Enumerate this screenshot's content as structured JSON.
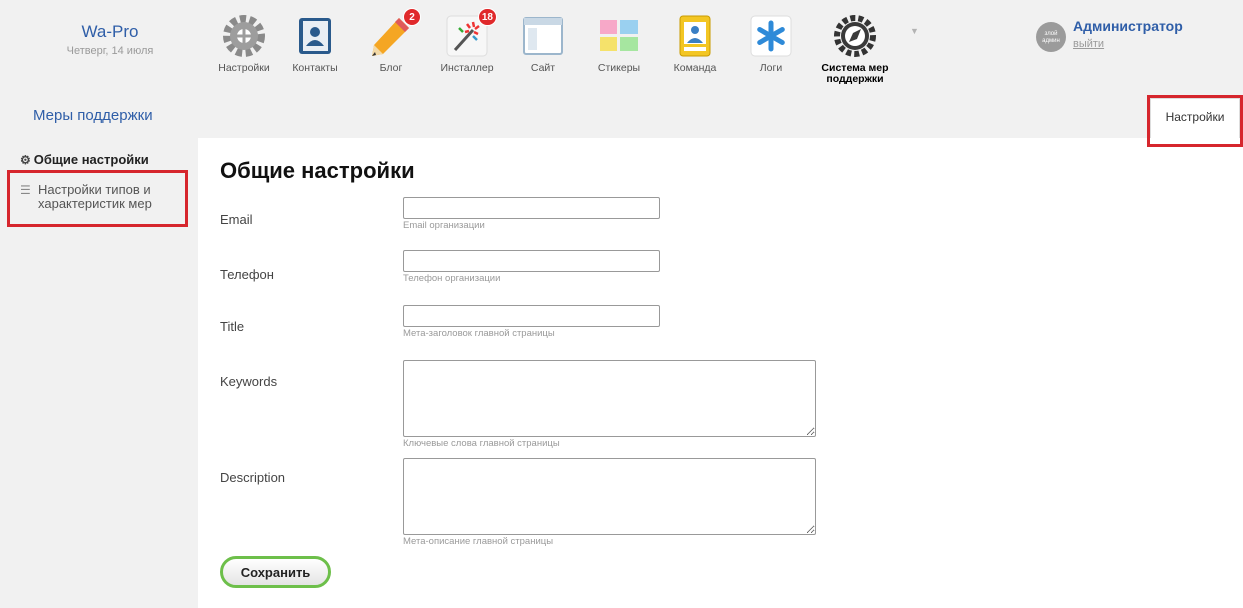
{
  "brand": {
    "name": "Wa-Pro",
    "date": "Четверг, 14 июля"
  },
  "apps": [
    {
      "label": "Настройки",
      "icon": "settings-gear-icon"
    },
    {
      "label": "Контакты",
      "icon": "contacts-book-icon"
    },
    {
      "label": "Блог",
      "icon": "pencil-icon",
      "badge": "2"
    },
    {
      "label": "Инсталлер",
      "icon": "installer-sparkle-icon",
      "badge": "18"
    },
    {
      "label": "Сайт",
      "icon": "site-window-icon"
    },
    {
      "label": "Стикеры",
      "icon": "stickers-icon"
    },
    {
      "label": "Команда",
      "icon": "team-badge-icon"
    },
    {
      "label": "Логи",
      "icon": "logs-asterisk-icon"
    },
    {
      "label": "Система мер поддержки",
      "icon": "support-system-compass-icon"
    }
  ],
  "user": {
    "avatar_text": "злой админ",
    "name": "Администратор",
    "logout": "выйти"
  },
  "app_header": {
    "title": "Меры поддержки",
    "tab_settings": "Настройки"
  },
  "sidebar": [
    {
      "label": "Общие настройки",
      "icon": "gears-icon",
      "active": true
    },
    {
      "label": "Настройки типов и характеристик мер",
      "icon": "list-icon",
      "active": false
    }
  ],
  "form": {
    "title": "Общие настройки",
    "fields": [
      {
        "label": "Email",
        "value": "",
        "hint": "Email организации"
      },
      {
        "label": "Телефон",
        "value": "",
        "hint": "Телефон организации"
      },
      {
        "label": "Title",
        "value": "",
        "hint": "Мета-заголовок главной страницы"
      },
      {
        "label": "Keywords",
        "value": "",
        "hint": "Ключевые слова главной страницы"
      },
      {
        "label": "Description",
        "value": "",
        "hint": "Мета-описание главной страницы"
      }
    ],
    "save_label": "Сохранить"
  },
  "colors": {
    "link": "#2f5ea8",
    "highlight": "#d6262d",
    "save_border": "#6dbf4a",
    "badge": "#e0292b"
  }
}
